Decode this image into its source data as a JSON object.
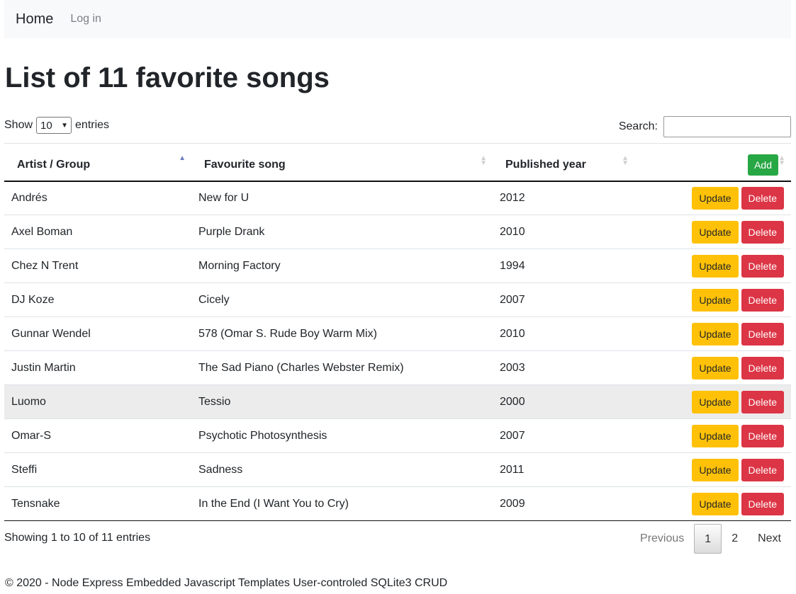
{
  "nav": {
    "brand": "Home",
    "login": "Log in"
  },
  "page": {
    "title": "List of 11 favorite songs"
  },
  "controls": {
    "show_label": "Show",
    "length_value": "10",
    "entries_label": "entries",
    "search_label": "Search:",
    "search_value": ""
  },
  "table": {
    "columns": [
      "Artist / Group",
      "Favourite song",
      "Published year"
    ],
    "add_label": "Add",
    "update_label": "Update",
    "delete_label": "Delete",
    "rows": [
      [
        "Andrés",
        "New for U",
        "2012"
      ],
      [
        "Axel Boman",
        "Purple Drank",
        "2010"
      ],
      [
        "Chez N Trent",
        "Morning Factory",
        "1994"
      ],
      [
        "DJ Koze",
        "Cicely",
        "2007"
      ],
      [
        "Gunnar Wendel",
        "578 (Omar S. Rude Boy Warm Mix)",
        "2010"
      ],
      [
        "Justin Martin",
        "The Sad Piano (Charles Webster Remix)",
        "2003"
      ],
      [
        "Luomo",
        "Tessio",
        "2000"
      ],
      [
        "Omar-S",
        "Psychotic Photosynthesis",
        "2007"
      ],
      [
        "Steffi",
        "Sadness",
        "2011"
      ],
      [
        "Tensnake",
        "In the End (I Want You to Cry)",
        "2009"
      ]
    ]
  },
  "pagination": {
    "info": "Showing 1 to 10 of 11 entries",
    "previous": "Previous",
    "pages": [
      "1",
      "2"
    ],
    "next": "Next"
  },
  "footer": {
    "text": "© 2020 - Node Express Embedded Javascript Templates User-controled SQLite3 CRUD"
  },
  "colors": {
    "add": "#28a745",
    "update": "#ffc107",
    "delete": "#dc3545",
    "navbar_bg": "#f8f9fa"
  }
}
